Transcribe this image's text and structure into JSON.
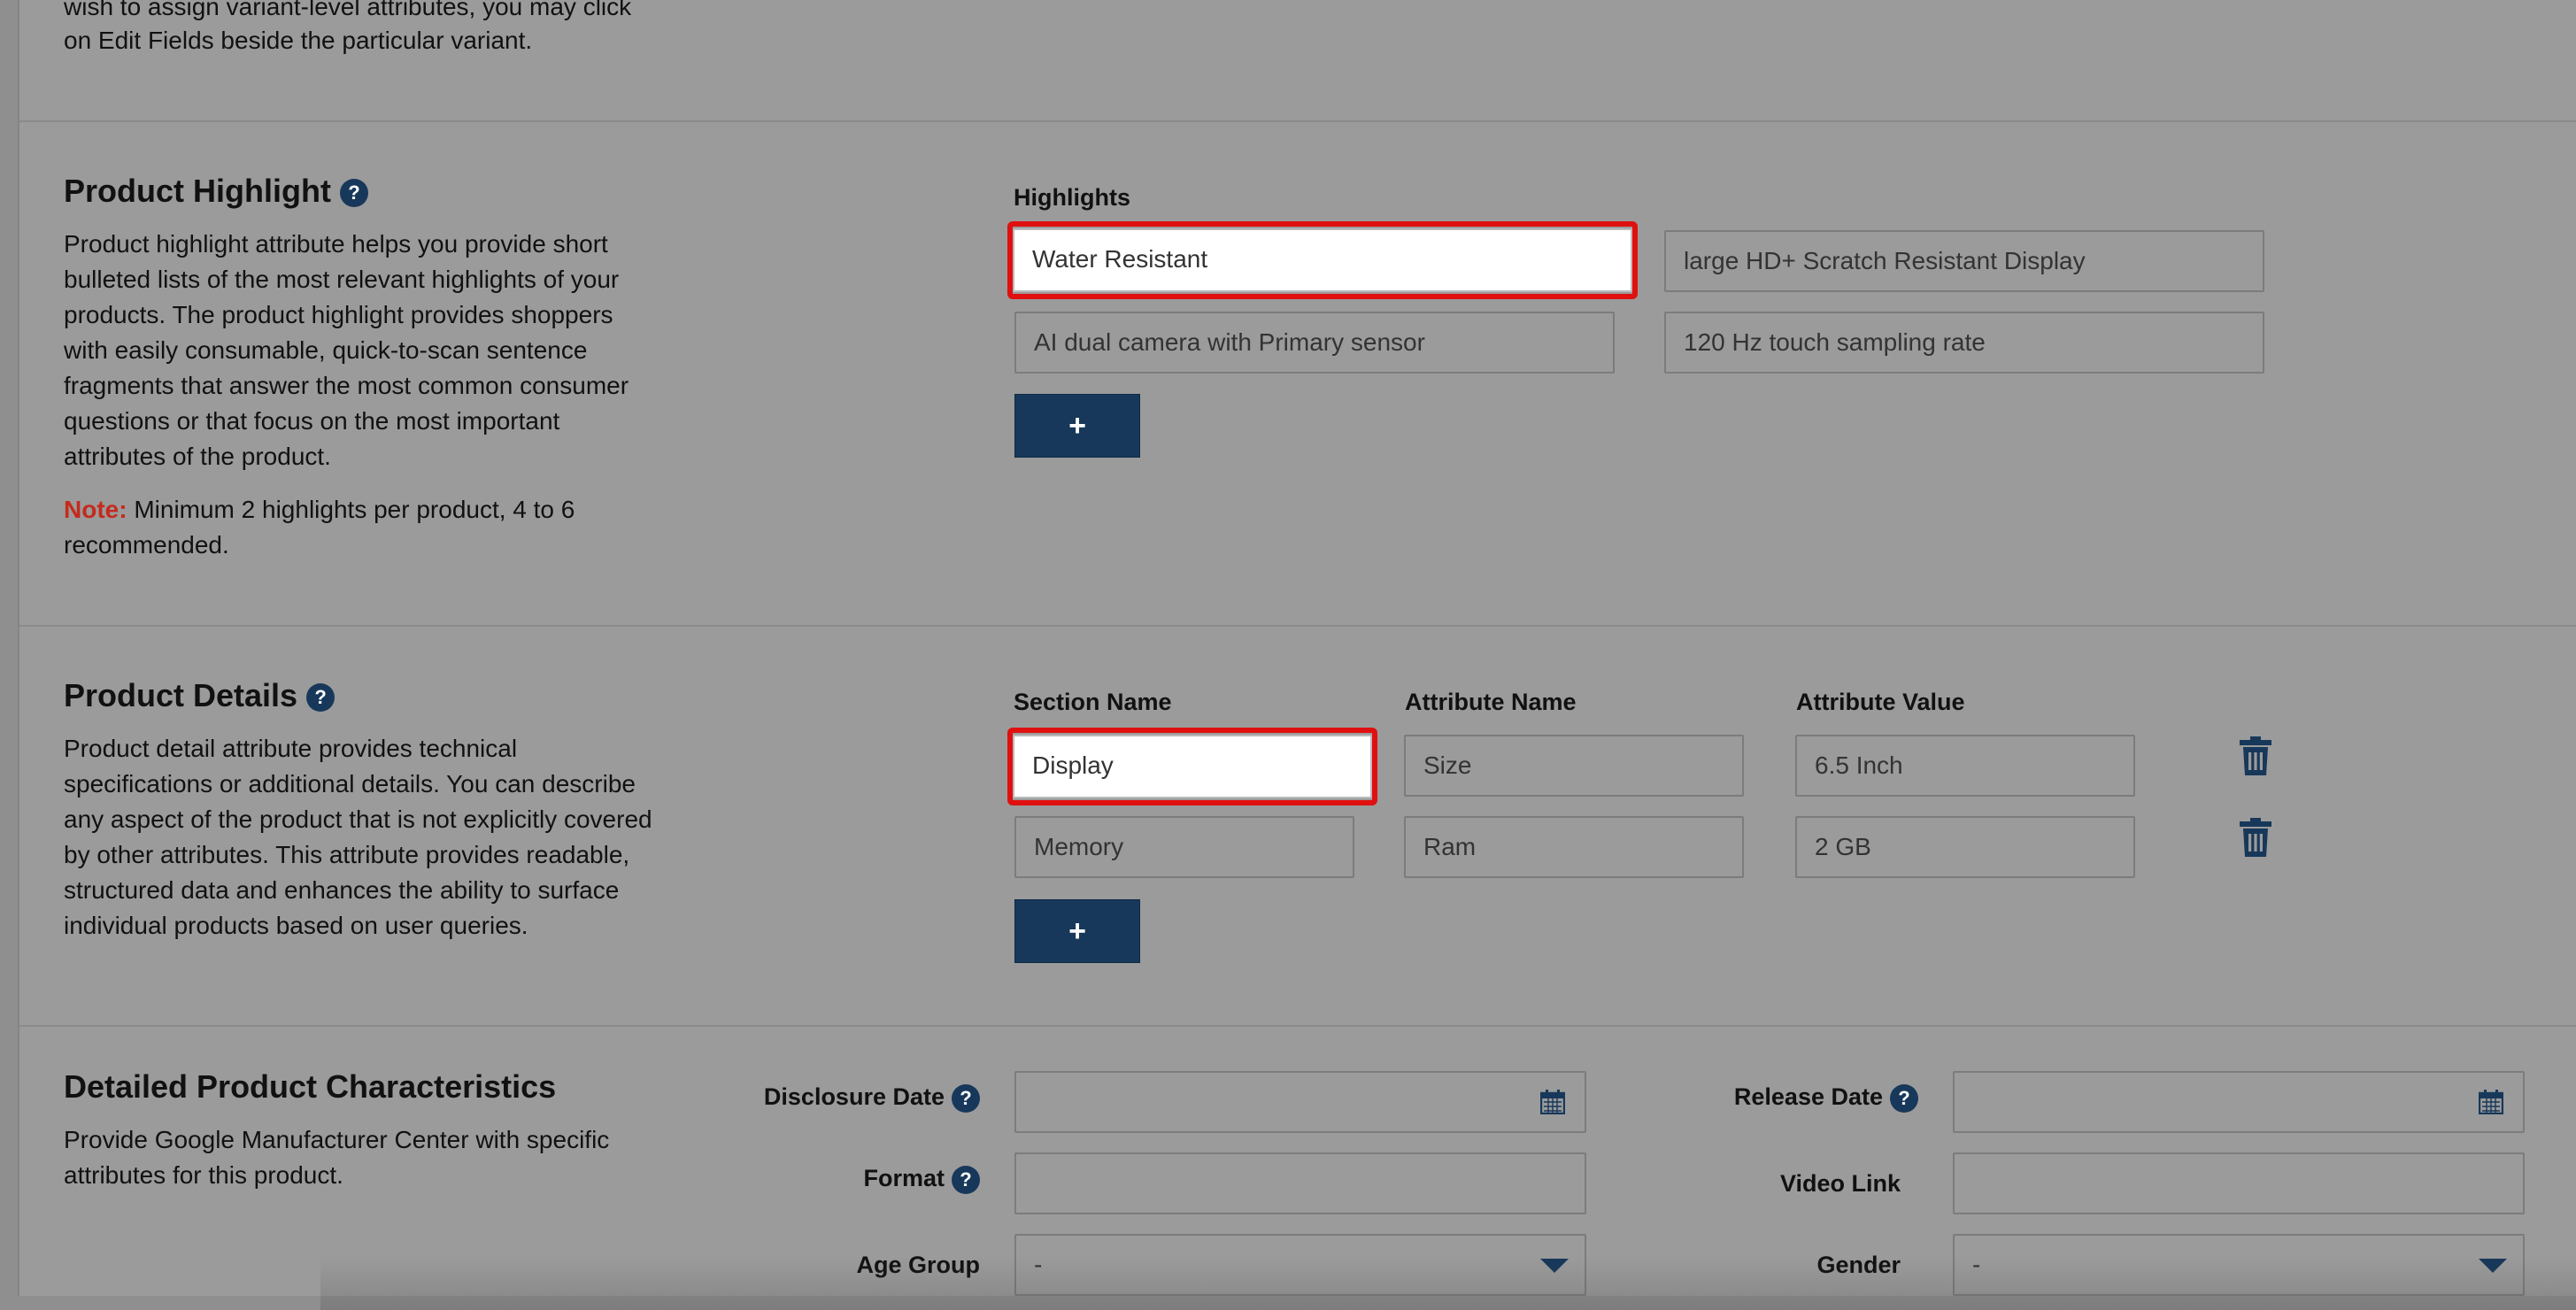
{
  "intro": {
    "line1": "wish to assign variant-level attributes, you may click",
    "line2": "on Edit Fields beside the particular variant."
  },
  "product_highlight": {
    "title": "Product Highlight",
    "description": [
      "Product highlight attribute helps you provide short",
      "bulleted lists of the most relevant highlights of your",
      "products. The product highlight provides shoppers",
      "with easily consumable, quick-to-scan sentence",
      "fragments that answer the most common consumer",
      "questions or that focus on the most important",
      "attributes of the product."
    ],
    "note_label": "Note:",
    "note_text_1": " Minimum 2 highlights per product, 4 to 6",
    "note_text_2": "recommended.",
    "field_label": "Highlights",
    "highlights": [
      "Water Resistant",
      "large HD+ Scratch Resistant Display",
      "AI dual camera with Primary sensor",
      "120 Hz touch sampling rate"
    ],
    "add_label": "+"
  },
  "product_details": {
    "title": "Product Details",
    "description": [
      "Product detail attribute provides technical",
      "specifications or additional details. You can describe",
      "any aspect of the product that is not explicitly covered",
      "by other attributes. This attribute provides readable,",
      "structured data and enhances the ability to surface",
      "individual products based on user queries."
    ],
    "columns": [
      "Section Name",
      "Attribute Name",
      "Attribute Value"
    ],
    "rows": [
      {
        "section": "Display",
        "attribute": "Size",
        "value": "6.5 Inch"
      },
      {
        "section": "Memory",
        "attribute": "Ram",
        "value": "2 GB"
      }
    ],
    "add_label": "+"
  },
  "characteristics": {
    "title": "Detailed Product Characteristics",
    "description": [
      "Provide Google Manufacturer Center with specific",
      "attributes for this product."
    ],
    "disclosure_date_label": "Disclosure Date",
    "release_date_label": "Release Date",
    "format_label": "Format",
    "video_link_label": "Video Link",
    "age_group_label": "Age Group",
    "gender_label": "Gender",
    "age_group_value": "-",
    "gender_value": "-"
  },
  "help_glyph": "?",
  "icons": [
    "question-icon",
    "trash-icon",
    "calendar-icon",
    "caret-down-icon"
  ],
  "colors": {
    "accent": "#17385a",
    "highlight_border": "#e01010",
    "note": "#c42a1c"
  }
}
